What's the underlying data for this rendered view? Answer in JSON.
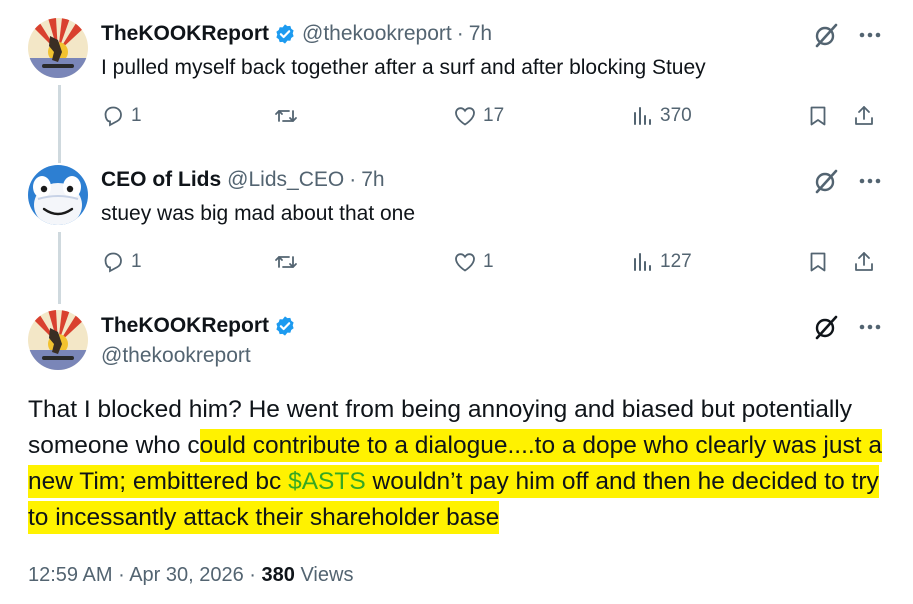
{
  "tweets": [
    {
      "name": "TheKOOKReport",
      "handle": "@thekookreport",
      "time": "7h",
      "text": "I pulled myself back together after a surf and after blocking Stuey",
      "replies": "1",
      "likes": "17",
      "views": "370"
    },
    {
      "name": "CEO of Lids",
      "handle": "@Lids_CEO",
      "time": "7h",
      "text": "stuey was big mad about that one",
      "replies": "1",
      "likes": "1",
      "views": "127"
    }
  ],
  "main": {
    "name": "TheKOOKReport",
    "handle": "@thekookreport",
    "text_part1": "That I blocked him?  He went from being annoying and biased but potentially someone who c",
    "text_part2": "ould contribute to a dialogue....to a dope who clearly was just a new Tim;",
    "text_part3": " embittered bc ",
    "cashtag": "$ASTS",
    "text_part4": " wouldn’t pay him off and then he decided to try to incessantly attack their shareholder base",
    "time": "12:59 AM",
    "date": "Apr 30, 2026",
    "views_count": "380",
    "views_label": "Views"
  },
  "colors": {
    "accent": "#1d9bf0",
    "verified": "#1d9bf0",
    "highlight": "#fff200"
  },
  "icons": [
    "verified-icon",
    "grok-icon",
    "more-icon",
    "reply-icon",
    "retweet-icon",
    "like-icon",
    "views-icon",
    "bookmark-icon",
    "share-icon"
  ]
}
